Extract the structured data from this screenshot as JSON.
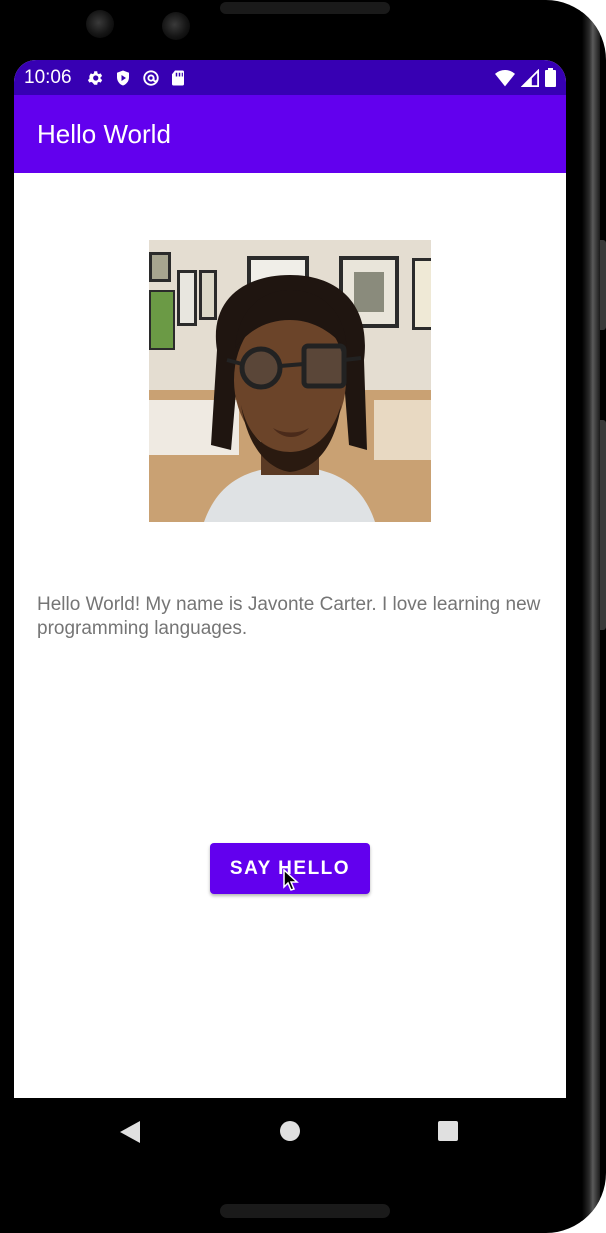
{
  "status_bar": {
    "time": "10:06",
    "left_icons": [
      "gear-icon",
      "play-protect-icon",
      "at-sign-icon",
      "sd-card-icon"
    ],
    "right_icons": [
      "wifi-icon",
      "signal-icon",
      "battery-icon"
    ],
    "background": "#3700b3"
  },
  "app_bar": {
    "title": "Hello World",
    "background": "#6200ee"
  },
  "main": {
    "profile_photo": "selfie-photo",
    "bio_text": "Hello World! My name is Javonte Carter. I love learning new programming languages.",
    "button_label": "SAY HELLO",
    "accent_color": "#6200ee"
  },
  "nav_bar": {
    "icons": [
      "back-icon",
      "home-icon",
      "recents-icon"
    ]
  }
}
